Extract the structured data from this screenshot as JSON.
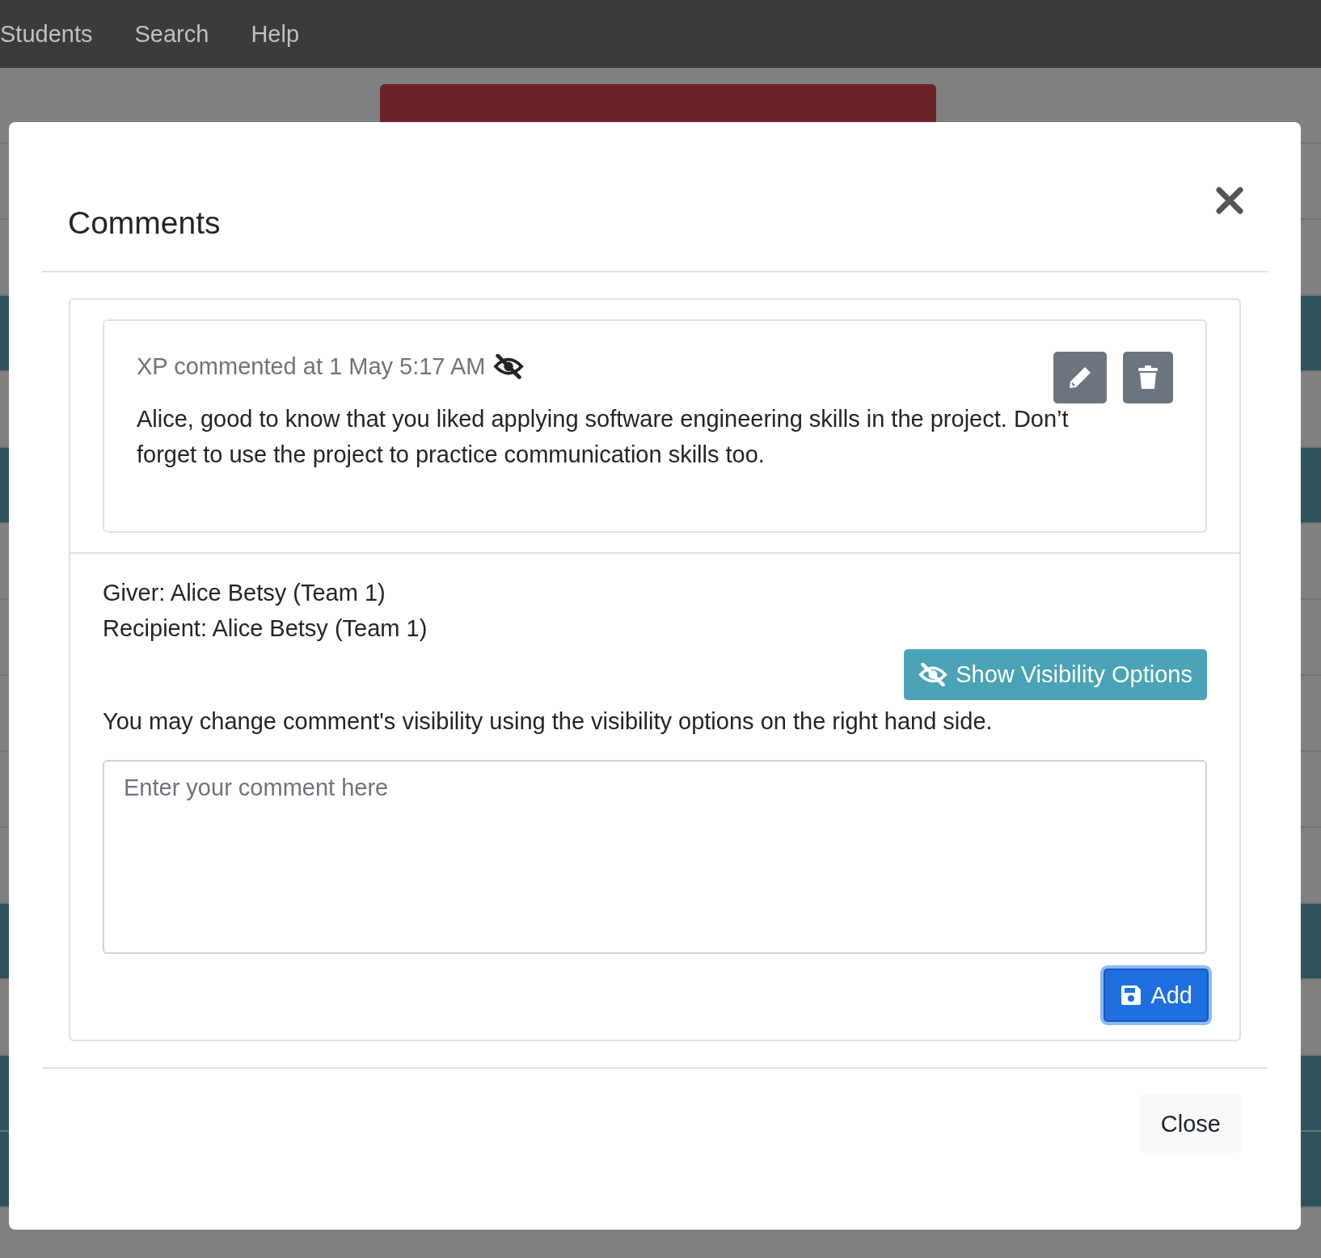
{
  "navbar": {
    "items": [
      "Students",
      "Search",
      "Help"
    ]
  },
  "modal": {
    "title": "Comments",
    "comment": {
      "author_line": "XP commented at 1 May 5:17 AM",
      "hidden": true,
      "text": "Alice, good to know that you liked applying software engineering skills in the project. Don’t forget to use the project to practice communication skills too."
    },
    "giver": "Giver: Alice Betsy (Team 1)",
    "recipient": "Recipient: Alice Betsy (Team 1)",
    "visibility_button": "Show Visibility Options",
    "hint": "You may change comment's visibility using the visibility options on the right hand side.",
    "comment_field": {
      "placeholder": "Enter your comment here"
    },
    "add_button": "Add",
    "close_button": "Close"
  }
}
